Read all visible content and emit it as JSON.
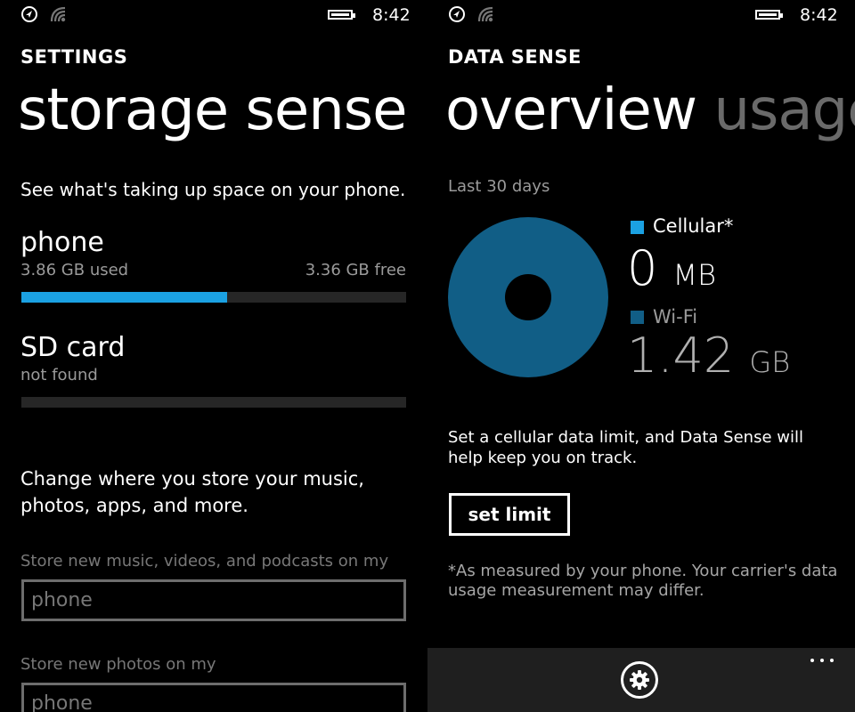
{
  "status_bar": {
    "time": "8:42",
    "icons": [
      "location-icon",
      "wifi-signal-icon",
      "battery-icon"
    ]
  },
  "storage": {
    "app_title": "SETTINGS",
    "page_title": "storage sense",
    "intro": "See what's taking up space on your phone.",
    "phone": {
      "title": "phone",
      "used": "3.86 GB used",
      "free": "3.36 GB free",
      "used_fraction": 0.535
    },
    "sd_card": {
      "title": "SD card",
      "status": "not found"
    },
    "change_text": "Change where you store your music, photos, apps, and more.",
    "music_label": "Store new music, videos, and podcasts on my",
    "music_value": "phone",
    "photos_label": "Store new photos on my",
    "photos_value": "phone"
  },
  "data_sense": {
    "app_title": "DATA SENSE",
    "pivot_current": "overview",
    "pivot_next": "usage",
    "period": "Last 30 days",
    "cellular": {
      "label": "Cellular*",
      "value": "0",
      "unit": "MB",
      "color": "#1ba1e2"
    },
    "wifi": {
      "label": "Wi-Fi",
      "value": "1.42",
      "unit": "GB",
      "color": "#115e86"
    },
    "info": "Set a cellular data limit, and Data Sense will help keep you on track.",
    "set_limit_label": "set limit",
    "note": "*As measured by your phone. Your carrier's data usage measurement may differ.",
    "appbar_icons": [
      "settings-gear-icon",
      "more-options-icon"
    ]
  },
  "colors": {
    "accent": "#1ba1e2",
    "background": "#000000",
    "appbar": "#1f1f1f"
  }
}
